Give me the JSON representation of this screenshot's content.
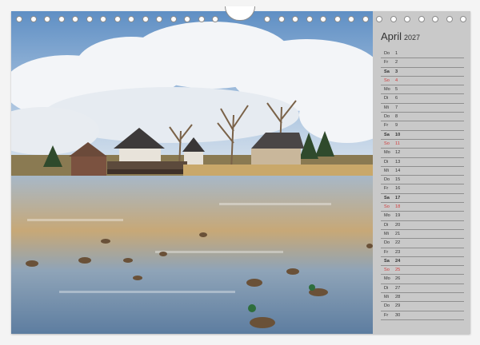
{
  "calendar": {
    "month": "April",
    "year": "2027",
    "days": [
      {
        "wd": "Do",
        "d": "1",
        "type": ""
      },
      {
        "wd": "Fr",
        "d": "2",
        "type": ""
      },
      {
        "wd": "Sa",
        "d": "3",
        "type": "sat"
      },
      {
        "wd": "So",
        "d": "4",
        "type": "sun"
      },
      {
        "wd": "Mo",
        "d": "5",
        "type": ""
      },
      {
        "wd": "Di",
        "d": "6",
        "type": ""
      },
      {
        "wd": "Mi",
        "d": "7",
        "type": ""
      },
      {
        "wd": "Do",
        "d": "8",
        "type": ""
      },
      {
        "wd": "Fr",
        "d": "9",
        "type": ""
      },
      {
        "wd": "Sa",
        "d": "10",
        "type": "sat"
      },
      {
        "wd": "So",
        "d": "11",
        "type": "sun"
      },
      {
        "wd": "Mo",
        "d": "12",
        "type": ""
      },
      {
        "wd": "Di",
        "d": "13",
        "type": ""
      },
      {
        "wd": "Mi",
        "d": "14",
        "type": ""
      },
      {
        "wd": "Do",
        "d": "15",
        "type": ""
      },
      {
        "wd": "Fr",
        "d": "16",
        "type": ""
      },
      {
        "wd": "Sa",
        "d": "17",
        "type": "sat"
      },
      {
        "wd": "So",
        "d": "18",
        "type": "sun"
      },
      {
        "wd": "Mo",
        "d": "19",
        "type": ""
      },
      {
        "wd": "Di",
        "d": "20",
        "type": ""
      },
      {
        "wd": "Mi",
        "d": "21",
        "type": ""
      },
      {
        "wd": "Do",
        "d": "22",
        "type": ""
      },
      {
        "wd": "Fr",
        "d": "23",
        "type": ""
      },
      {
        "wd": "Sa",
        "d": "24",
        "type": "sat"
      },
      {
        "wd": "So",
        "d": "25",
        "type": "sun"
      },
      {
        "wd": "Mo",
        "d": "26",
        "type": ""
      },
      {
        "wd": "Di",
        "d": "27",
        "type": ""
      },
      {
        "wd": "Mi",
        "d": "28",
        "type": ""
      },
      {
        "wd": "Do",
        "d": "29",
        "type": ""
      },
      {
        "wd": "Fr",
        "d": "30",
        "type": ""
      }
    ]
  },
  "colors": {
    "panel": "#c9c9c9",
    "line": "#8f8f8f",
    "text": "#333333",
    "sunday": "#d23b3b"
  },
  "photo": {
    "subject": "lake-with-ducks-and-houses"
  }
}
